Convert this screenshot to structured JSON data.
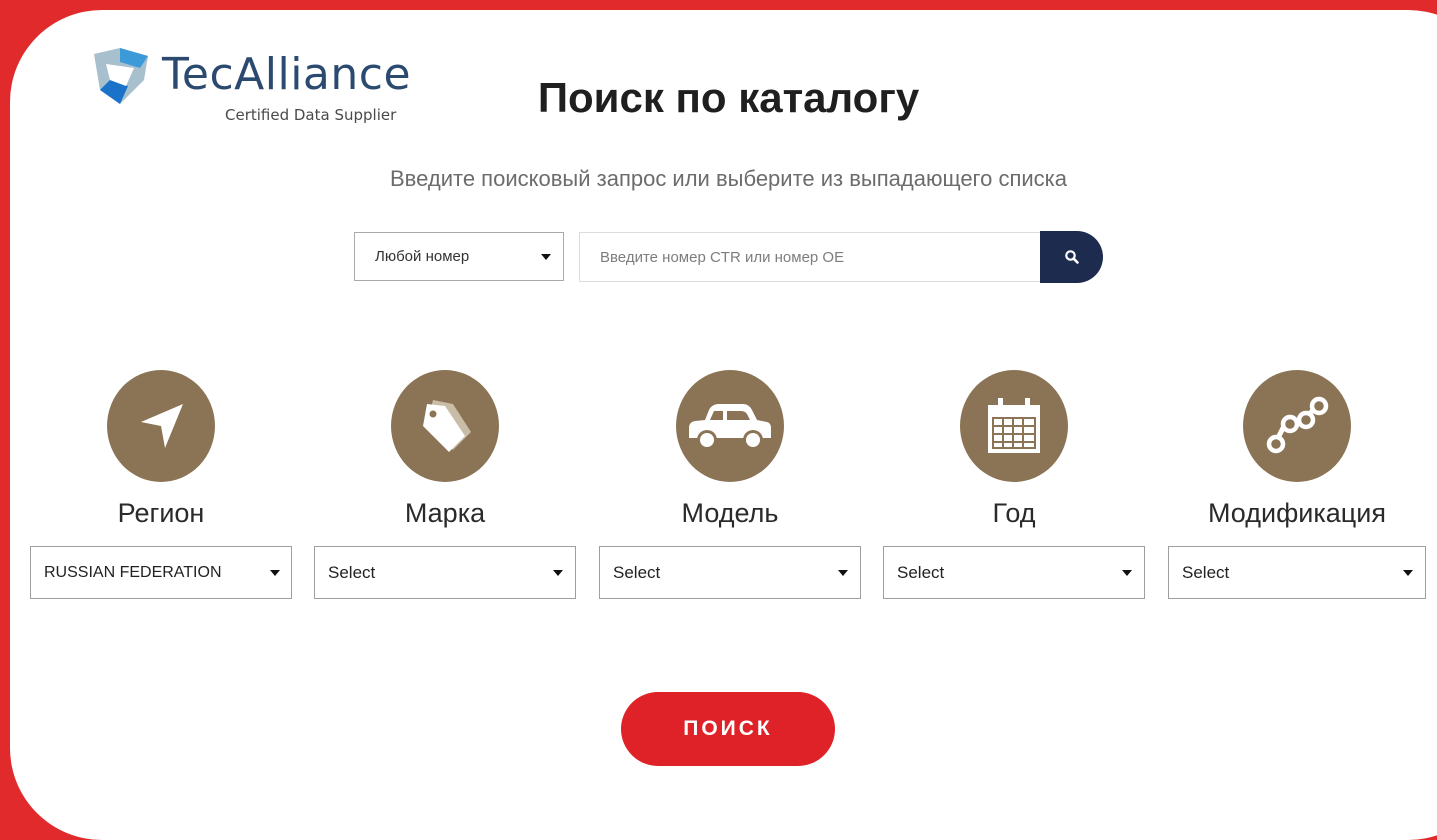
{
  "logo": {
    "name": "TecAlliance",
    "tagline": "Certified Data Supplier"
  },
  "page": {
    "title": "Поиск по каталогу",
    "subtitle": "Введите поисковый запрос или выберите из выпадающего списка"
  },
  "search": {
    "type_select_value": "Любой номер",
    "placeholder": "Введите номер CTR или номер OE",
    "button_icon": "search-icon"
  },
  "filters": [
    {
      "label": "Регион",
      "icon": "navigation-arrow-icon",
      "value": "RUSSIAN FEDERATION"
    },
    {
      "label": "Марка",
      "icon": "tag-icon",
      "value": "Select"
    },
    {
      "label": "Модель",
      "icon": "car-icon",
      "value": "Select"
    },
    {
      "label": "Год",
      "icon": "calendar-icon",
      "value": "Select"
    },
    {
      "label": "Модификация",
      "icon": "nodes-icon",
      "value": "Select"
    }
  ],
  "submit": {
    "label": "ПОИСК"
  },
  "colors": {
    "background_red": "#e12a2c",
    "icon_circle_brown": "#8a7455",
    "search_button_navy": "#1d2b4f",
    "submit_button_red": "#df2228"
  }
}
